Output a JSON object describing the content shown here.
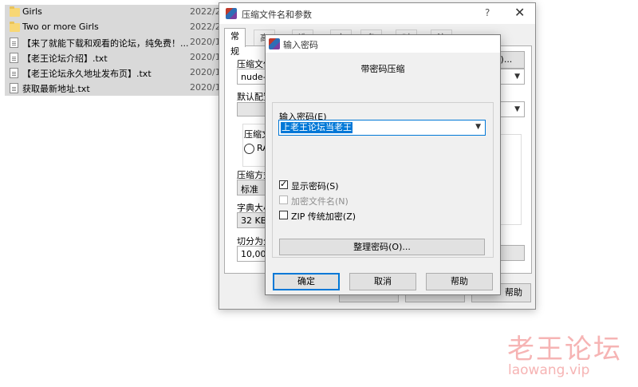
{
  "file_list": [
    {
      "type": "folder",
      "name": "Girls",
      "date": "2022/2"
    },
    {
      "type": "folder",
      "name": "Two  or more Girls",
      "date": "2022/2"
    },
    {
      "type": "txt",
      "name": "【来了就能下载和观看的论坛，纯免费！...",
      "date": "2020/1"
    },
    {
      "type": "txt",
      "name": "【老王论坛介绍】.txt",
      "date": "2020/1"
    },
    {
      "type": "txt",
      "name": "【老王论坛永久地址发布页】.txt",
      "date": "2020/1"
    },
    {
      "type": "txt",
      "name": "获取最新地址.txt",
      "date": "2020/1"
    }
  ],
  "archive_dialog": {
    "title": "压缩文件名和参数",
    "help_glyph": "?",
    "close_glyph": "✕",
    "tabs": [
      "常规",
      "高",
      "选",
      "文",
      "备",
      "时",
      "注"
    ],
    "archive_name_label": "压缩文件",
    "archive_name_value": "nude-in-",
    "browse_button": "浏览(B)...",
    "profile_label": "默认配置",
    "format_group_label": "压缩文",
    "format_rar": "RAR",
    "method_label": "压缩方式",
    "method_value": "标准",
    "dict_label": "字典大小",
    "dict_value": "32 KB",
    "split_label": "切分为分",
    "split_value": "10,000 M",
    "help_button": "帮助"
  },
  "password_dialog": {
    "title": "输入密码",
    "subtitle": "带密码压缩",
    "password_label": "输入密码(E)",
    "password_value": "上老王论坛当老王",
    "show_password": "显示密码(S)",
    "show_password_checked": true,
    "encrypt_names": "加密文件名(N)",
    "encrypt_names_checked": false,
    "zip_legacy": "ZIP 传统加密(Z)",
    "zip_legacy_checked": false,
    "organize_button": "整理密码(O)...",
    "ok_button": "确定",
    "cancel_button": "取消",
    "help_button": "帮助"
  },
  "watermark": {
    "text": "老王论坛",
    "url": "laowang.vip"
  },
  "colors": {
    "selection": "#0078d7",
    "list_row": "#d9d9d9",
    "dialog_bg": "#f0f0f0",
    "watermark": "#f6b4b4",
    "folder": "#f8d775"
  }
}
